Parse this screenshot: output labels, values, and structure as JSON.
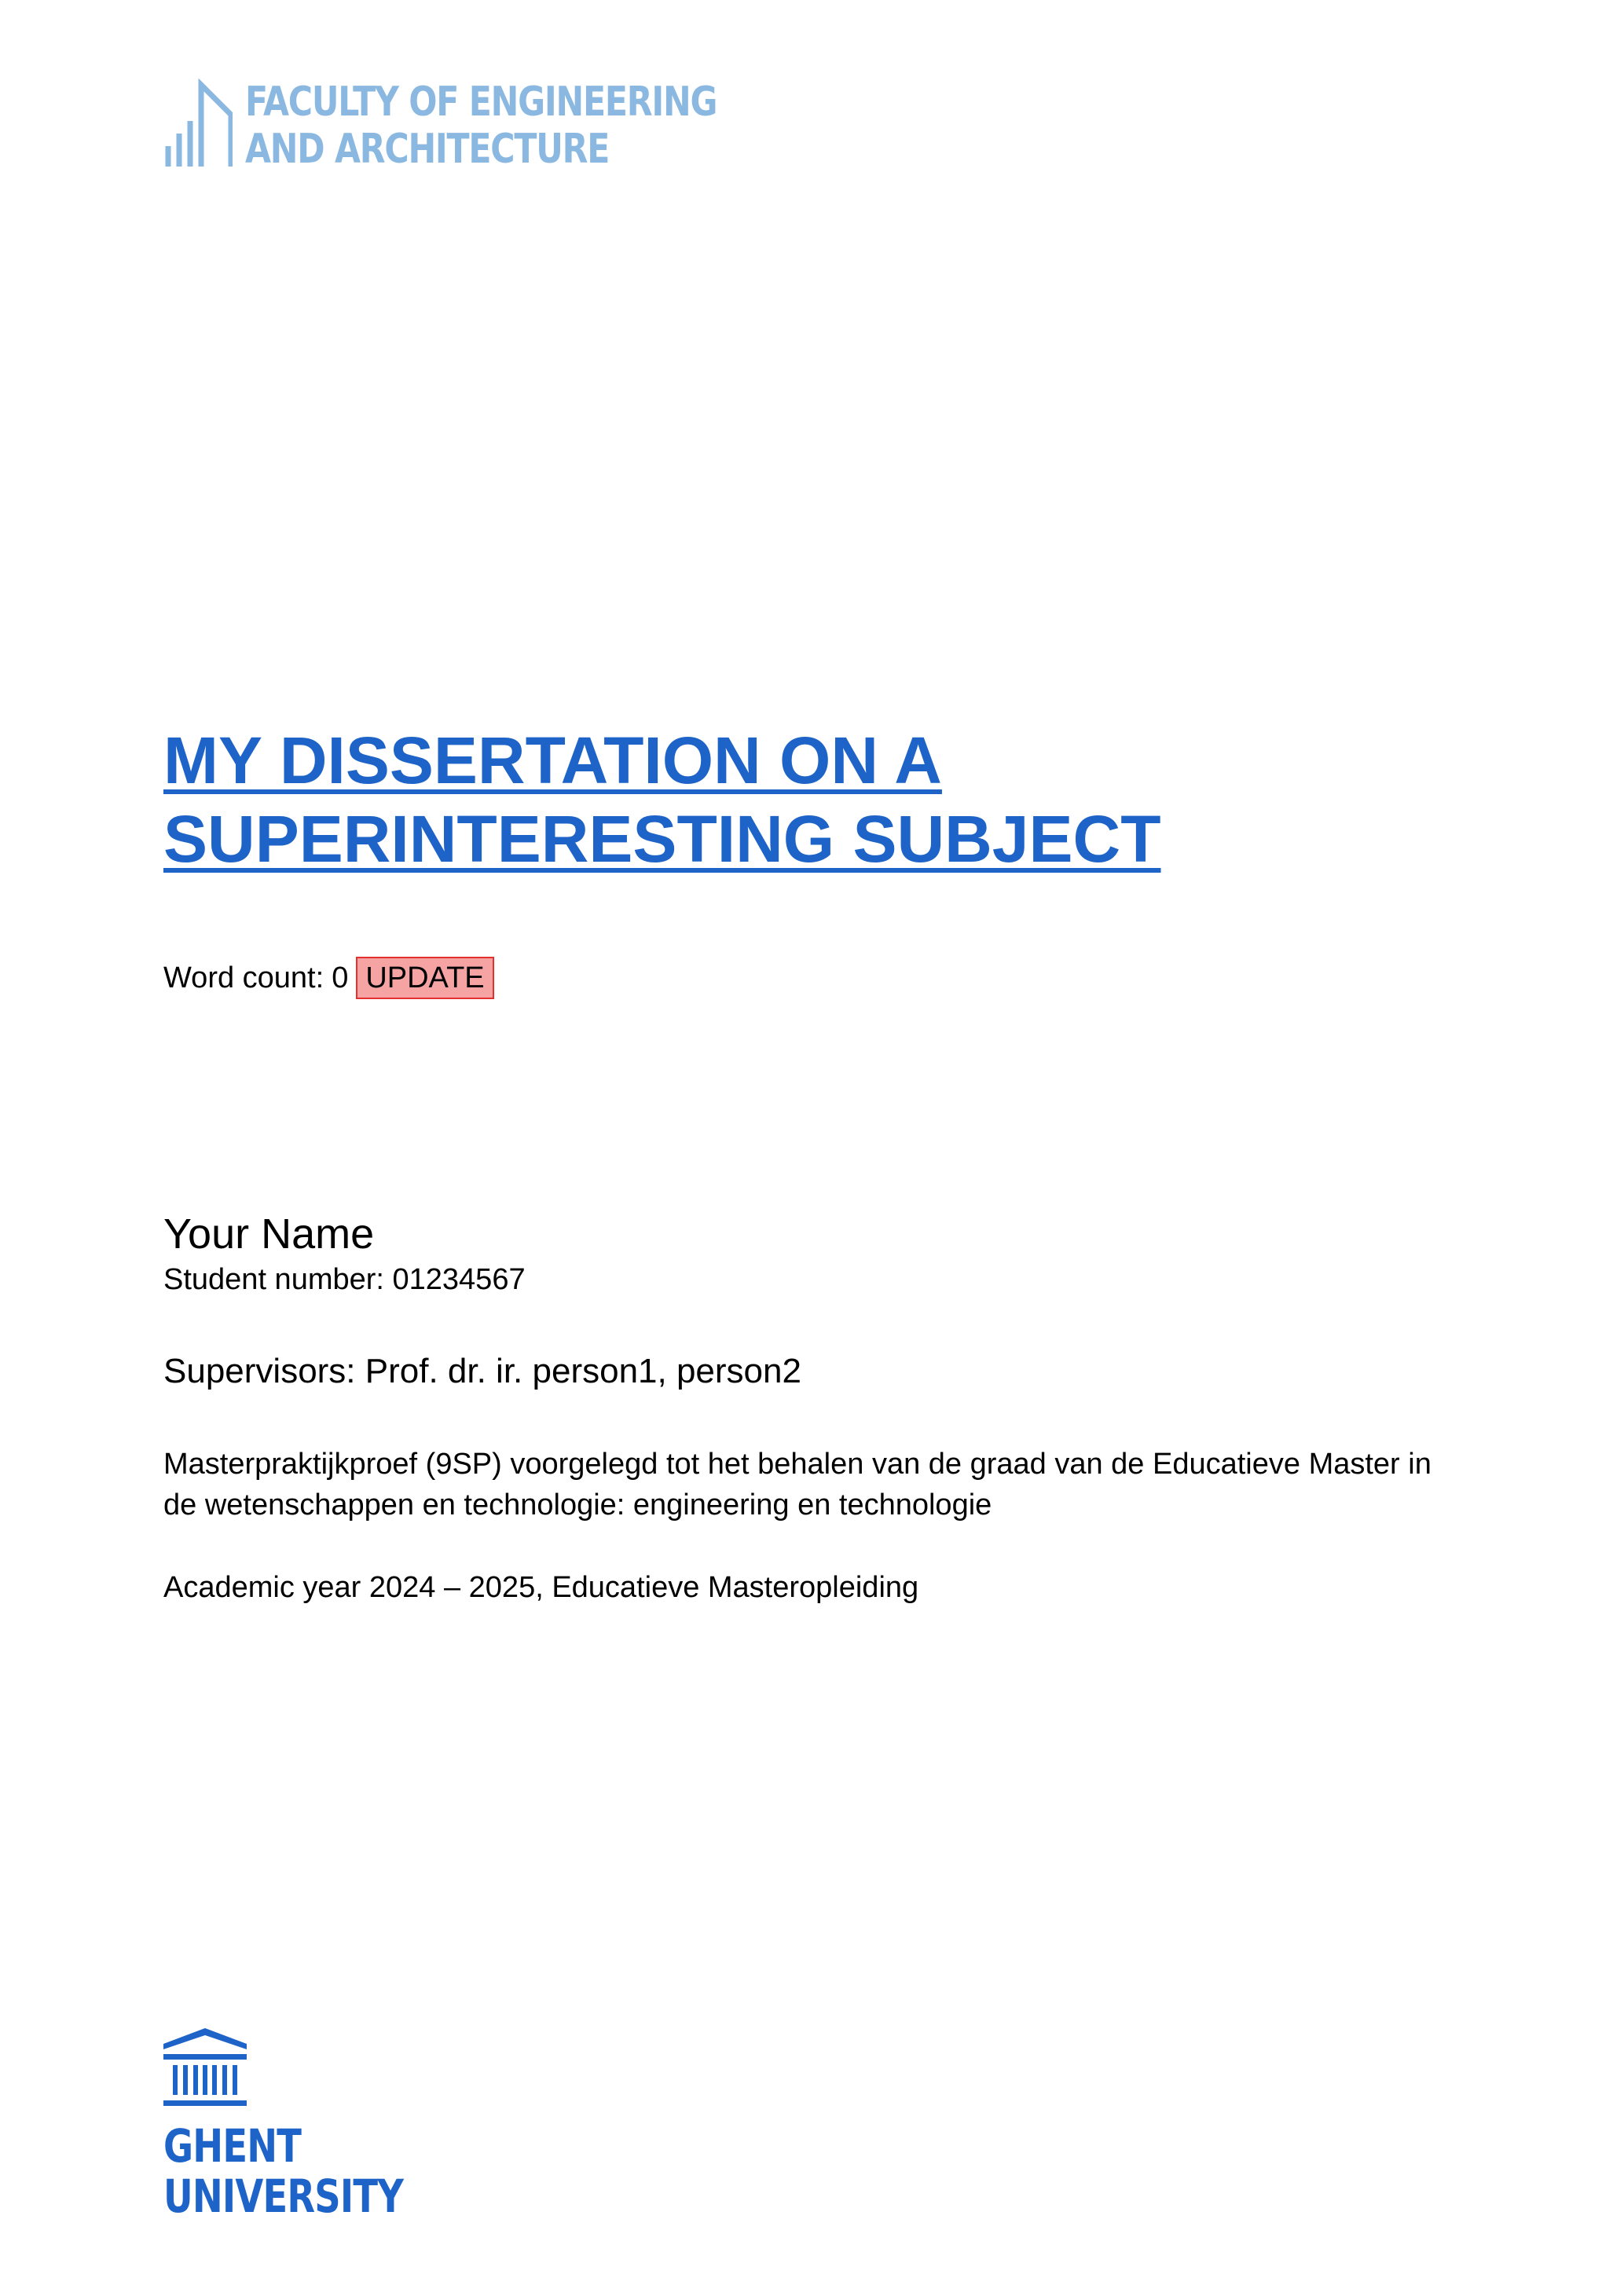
{
  "colors": {
    "faculty_logo": "#8AB8E0",
    "primary_blue": "#1E64C8",
    "badge_background": "#F5A3A3",
    "badge_border": "#E53030",
    "text": "#000000"
  },
  "header": {
    "faculty_logo": {
      "icon": "faculty-building-icon",
      "lines": [
        "FACULTY OF ENGINEERING",
        "AND ARCHITECTURE"
      ]
    }
  },
  "title": {
    "lines": [
      "MY DISSERTATION ON A",
      "SUPERINTERESTING SUBJECT"
    ]
  },
  "word_count": {
    "label": "Word count:",
    "value": "0",
    "update_label": "UPDATE"
  },
  "author": {
    "name": "Your Name",
    "student_number": "Student number: 01234567"
  },
  "supervisors": "Supervisors: Prof. dr. ir. person1, person2",
  "degree": "Masterpraktijkproef (9SP) voorgelegd tot het behalen van de graad van de Educatieve Master in de wetenschappen en technologie: engineering en technologie",
  "academic_year": "Academic year 2024 – 2025, Educatieve Masteropleiding",
  "footer": {
    "university_logo": {
      "icon": "university-building-icon",
      "lines": [
        "GHENT",
        "UNIVERSITY"
      ]
    }
  }
}
